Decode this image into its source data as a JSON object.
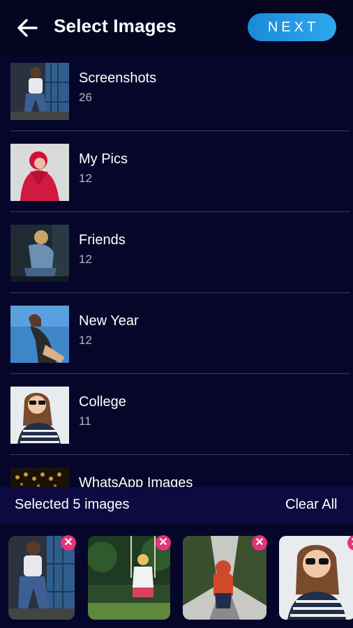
{
  "header": {
    "title": "Select Images",
    "next_label": "NEXT"
  },
  "albums": [
    {
      "name": "Screenshots",
      "count": "26"
    },
    {
      "name": "My Pics",
      "count": "12"
    },
    {
      "name": "Friends",
      "count": "12"
    },
    {
      "name": "New Year",
      "count": "12"
    },
    {
      "name": "College",
      "count": "11"
    },
    {
      "name": "WhatsApp Images",
      "count": ""
    }
  ],
  "selection": {
    "status": "Selected 5 images",
    "clear_label": "Clear All",
    "remove_glyph": "✕"
  },
  "colors": {
    "background": "#06062a",
    "accent": "#1f95e2",
    "remove_badge": "#e8327a",
    "selection_bar": "#0c0a40"
  },
  "icons": {
    "back": "arrow-left-icon",
    "remove": "close-icon"
  }
}
